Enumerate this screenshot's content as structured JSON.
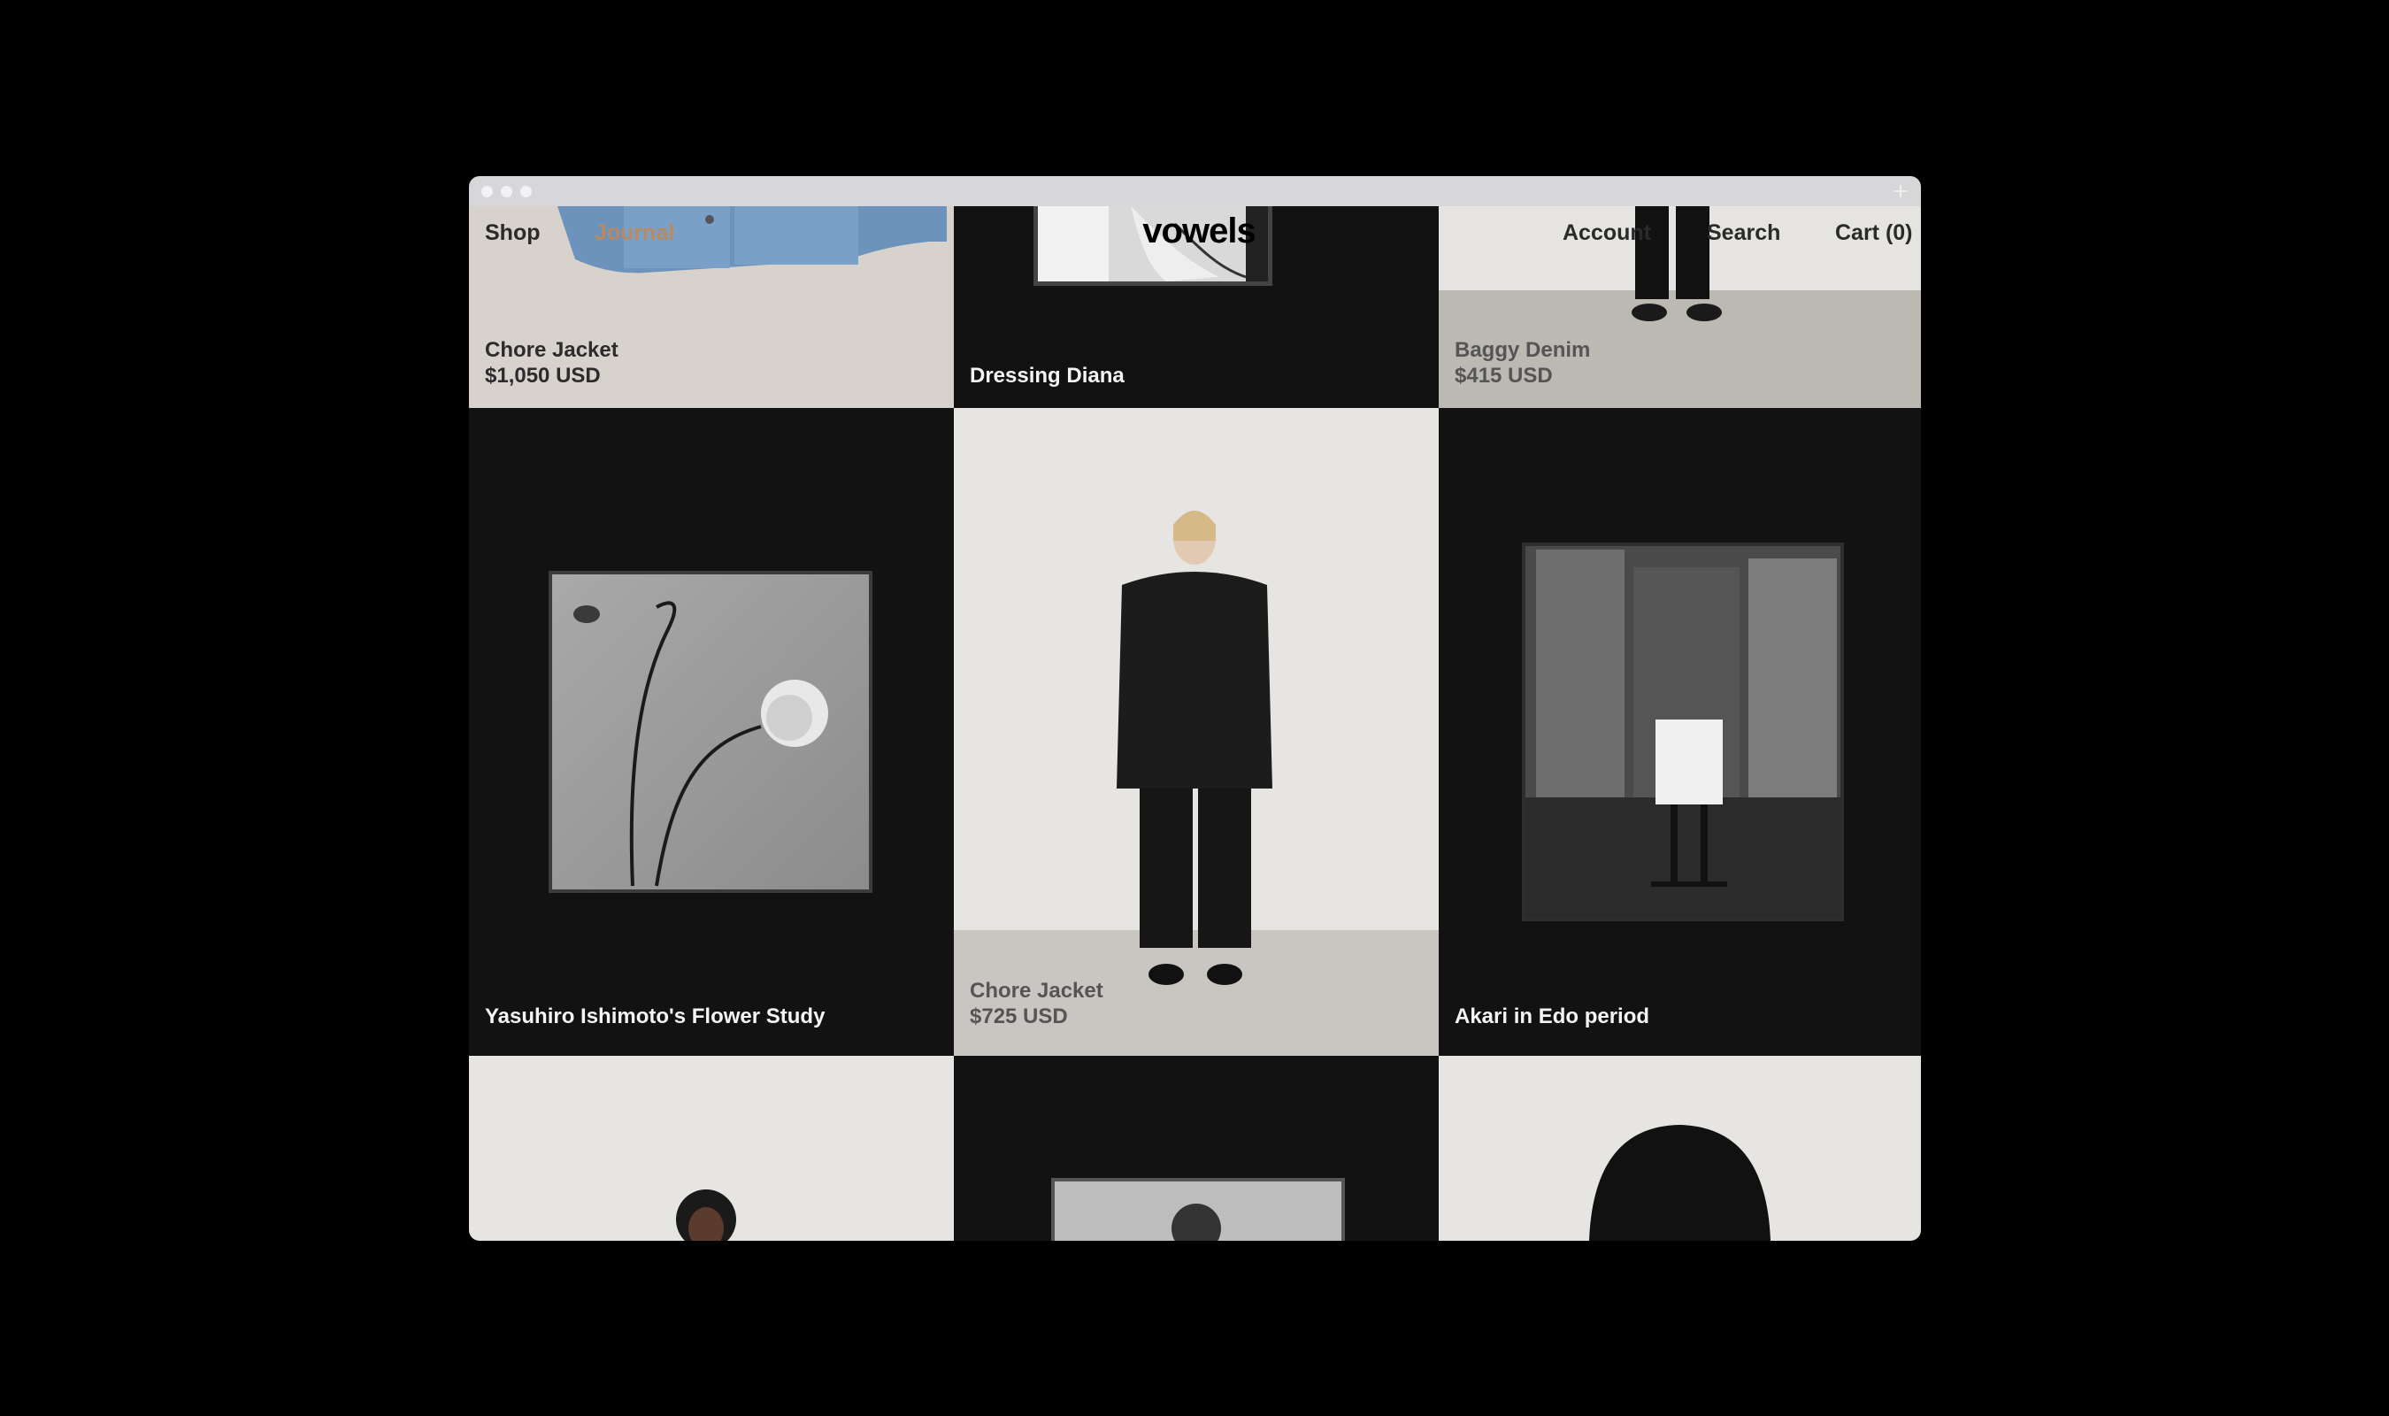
{
  "window": {
    "traffic_lights": [
      "close",
      "minimize",
      "zoom"
    ],
    "new_tab_icon": "plus-icon"
  },
  "header": {
    "shop": "Shop",
    "journal": "Journal",
    "logo": "vowels",
    "account": "Account",
    "search": "Search",
    "cart": "Cart (0)"
  },
  "tiles": [
    {
      "title": "Chore Jacket",
      "price": "$1,050 USD"
    },
    {
      "title": "Dressing Diana"
    },
    {
      "title": "Baggy Denim",
      "price": "$415 USD"
    },
    {
      "title": "Yasuhiro Ishimoto's Flower Study"
    },
    {
      "title": "Chore Jacket",
      "price": "$725 USD"
    },
    {
      "title": "Akari in Edo period"
    },
    {
      "title": ""
    },
    {
      "title": ""
    },
    {
      "title": ""
    }
  ],
  "colors": {
    "dark_tile": "#121212",
    "light_tile": "#e7e6e3",
    "titlebar": "#d7d7d9"
  }
}
